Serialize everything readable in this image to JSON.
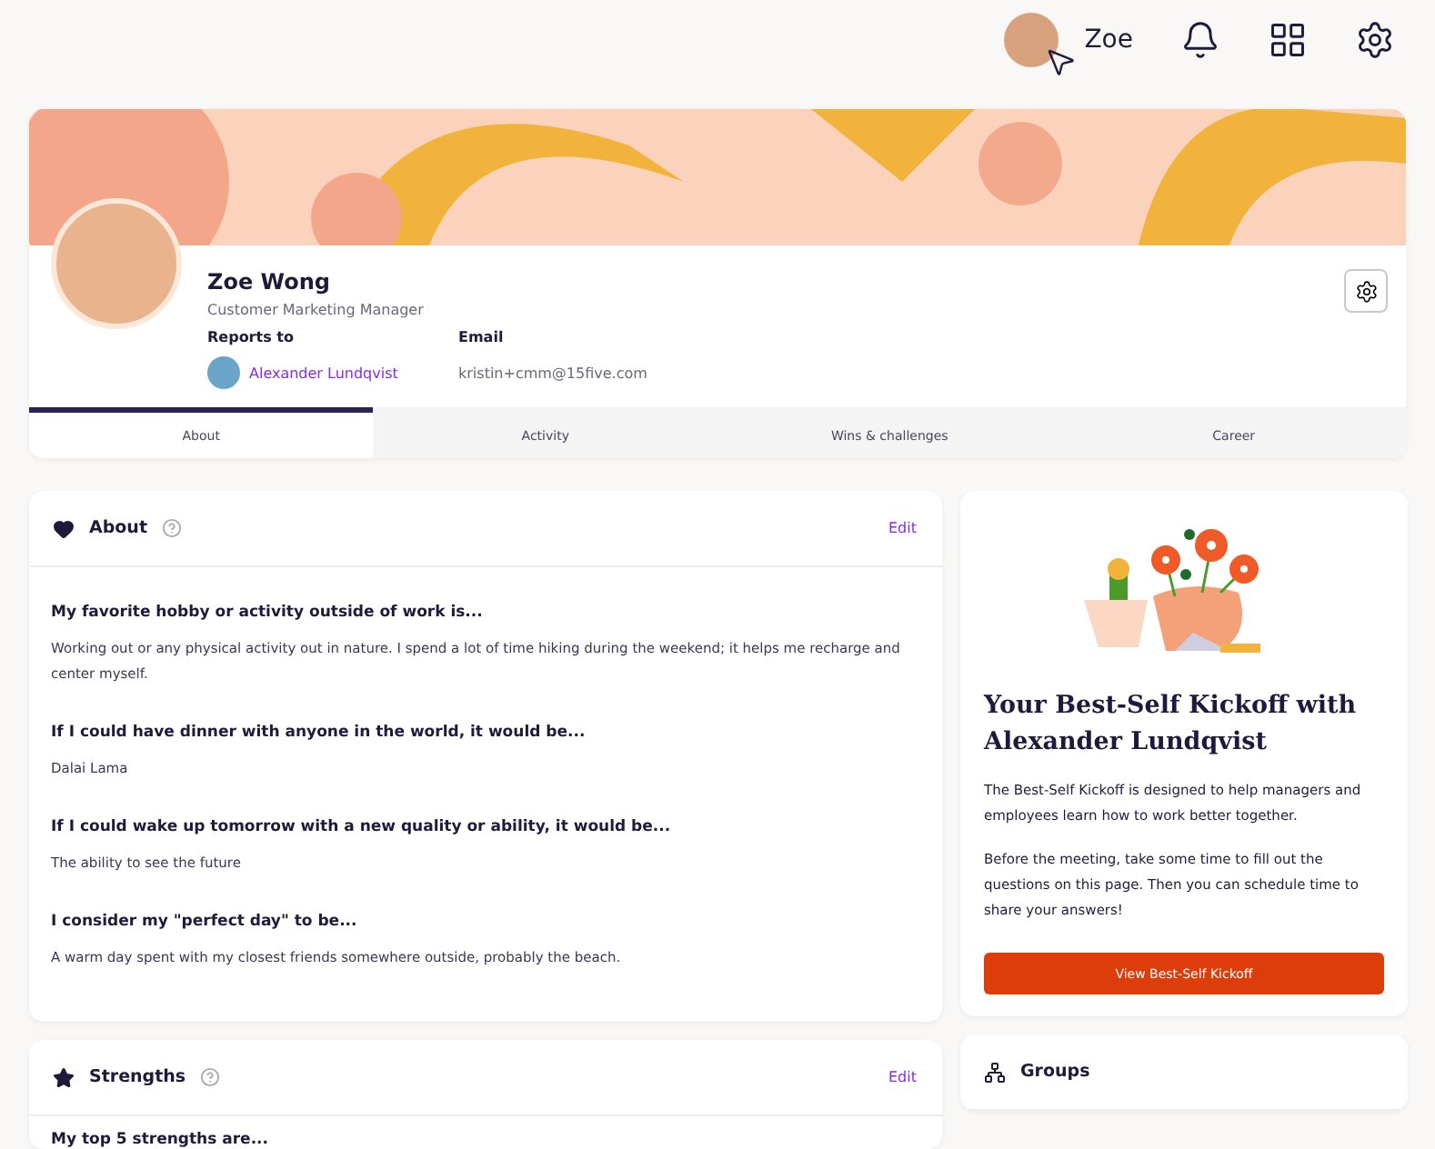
{
  "topbar": {
    "user_name": "Zoe"
  },
  "profile": {
    "name": "Zoe Wong",
    "job_title": "Customer Marketing Manager",
    "reports_to_label": "Reports to",
    "manager_name": "Alexander Lundqvist",
    "email_label": "Email",
    "email": "kristin+cmm@15five.com"
  },
  "tabs": [
    {
      "label": "About",
      "selected": true
    },
    {
      "label": "Activity",
      "selected": false
    },
    {
      "label": "Wins & challenges",
      "selected": false
    },
    {
      "label": "Career",
      "selected": false
    }
  ],
  "about": {
    "title": "About",
    "edit": "Edit",
    "qa": [
      {
        "question": "My favorite hobby or activity outside of work is...",
        "answer": "Working out or any physical activity out in nature. I spend a lot of time hiking during the weekend; it helps me recharge and center myself."
      },
      {
        "question": "If I could have dinner with anyone in the world, it would be...",
        "answer": "Dalai Lama"
      },
      {
        "question": "If I could wake up tomorrow with a new quality or ability, it would be...",
        "answer": "The ability to see the future"
      },
      {
        "question": "I consider my \"perfect day\" to be...",
        "answer": "A warm day spent with my closest friends somewhere outside, probably the beach."
      }
    ]
  },
  "strengths": {
    "title": "Strengths",
    "edit": "Edit",
    "intro": "My top 5 strengths are..."
  },
  "kickoff": {
    "title": "Your Best-Self Kickoff with Alexander Lundqvist",
    "paragraphs": [
      "The Best-Self Kickoff is designed to help managers and employees learn how to work better together.",
      "Before the meeting, take some time to fill out the questions on this page. Then you can schedule time to share your answers!"
    ],
    "button": "View Best-Self Kickoff"
  },
  "groups": {
    "title": "Groups"
  }
}
